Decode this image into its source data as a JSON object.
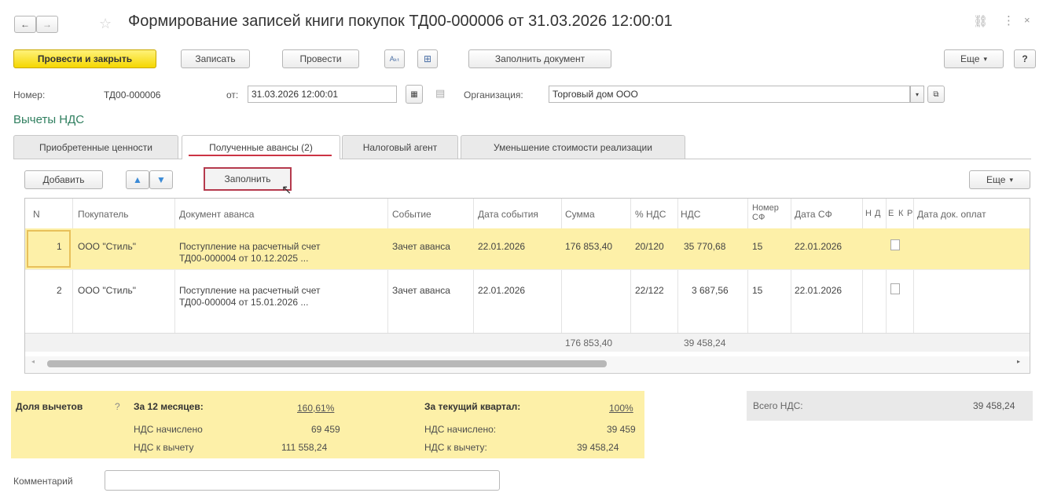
{
  "window": {
    "title": "Формирование записей книги покупок ТД00-000006 от 31.03.2026 12:00:01",
    "nav_back": "←",
    "nav_forward": "→"
  },
  "toolbar": {
    "post_close_label": "Провести и закрыть",
    "save_label": "Записать",
    "post_label": "Провести",
    "fill_document_label": "Заполнить документ",
    "more_label": "Еще",
    "help_label": "?"
  },
  "header": {
    "number_label": "Номер:",
    "number_value": "ТД00-000006",
    "date_label": "от:",
    "date_value": "31.03.2026 12:00:01",
    "org_label": "Организация:",
    "org_value": "Торговый дом ООО"
  },
  "section_title": "Вычеты НДС",
  "tabs": [
    {
      "label": "Приобретенные ценности"
    },
    {
      "label": "Полученные авансы (2)"
    },
    {
      "label": "Налоговый агент"
    },
    {
      "label": "Уменьшение стоимости реализации"
    }
  ],
  "table_toolbar": {
    "add_label": "Добавить",
    "fill_label": "Заполнить",
    "more_label": "Еще"
  },
  "table": {
    "columns": [
      "N",
      "Покупатель",
      "Документ аванса",
      "Событие",
      "Дата события",
      "Сумма",
      "% НДС",
      "НДС",
      "Номер СФ",
      "Дата СФ",
      "Н",
      "Д",
      "Е",
      "К",
      "Р",
      "Дата док. оплат"
    ],
    "rows": [
      {
        "n": "1",
        "buyer": "ООО \"Стиль\"",
        "doc_line1": "Поступление на расчетный счет",
        "doc_line2": "ТД00-000004 от 10.12.2025 ...",
        "event": "Зачет аванса",
        "event_date": "22.01.2026",
        "sum": "176 853,40",
        "vat_rate": "20/120",
        "vat": "35 770,68",
        "sf_number": "15",
        "sf_date": "22.01.2026"
      },
      {
        "n": "2",
        "buyer": "ООО \"Стиль\"",
        "doc_line1": "Поступление на расчетный счет",
        "doc_line2": "ТД00-000004 от 15.01.2026 ...",
        "event": "Зачет аванса",
        "event_date": "22.01.2026",
        "sum": "",
        "vat_rate": "22/122",
        "vat": "3 687,56",
        "sf_number": "15",
        "sf_date": "22.01.2026"
      }
    ],
    "totals": {
      "sum": "176 853,40",
      "vat": "39 458,24"
    }
  },
  "summary": {
    "share_label": "Доля вычетов",
    "help": "?",
    "months12_label": "За 12 месяцев:",
    "months12_value": "160,61%",
    "accrued_label": "НДС начислено",
    "accrued_value": "69 459",
    "deduct_label": "НДС к вычету",
    "deduct_value": "111 558,24",
    "quarter_label": "За текущий квартал:",
    "quarter_value": "100%",
    "q_accrued_label": "НДС начислено:",
    "q_accrued_value": "39 459",
    "q_deduct_label": "НДС к вычету:",
    "q_deduct_value": "39 458,24",
    "total_vat_label": "Всего НДС:",
    "total_vat_value": "39 458,24"
  },
  "comment": {
    "label": "Комментарий",
    "value": ""
  },
  "colors": {
    "accent_yellow": "#fdf0a8",
    "primary_button": "#f5d700",
    "tab_underline": "#cc3344",
    "section_title": "#2f7f5f"
  }
}
